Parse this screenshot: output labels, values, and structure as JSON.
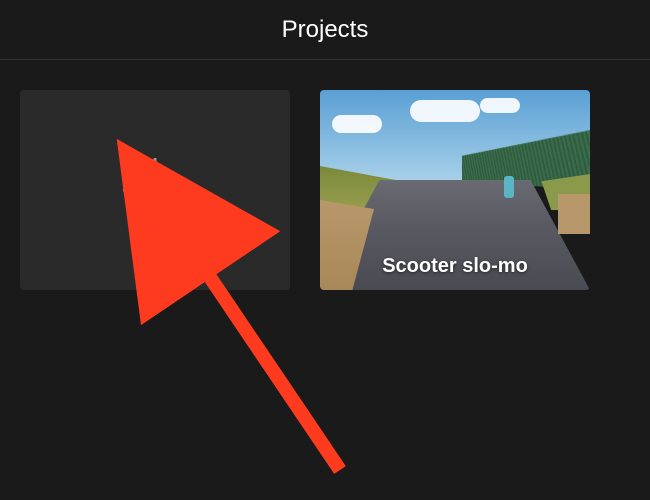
{
  "header": {
    "title": "Projects"
  },
  "projects": {
    "new_button": {
      "icon": "plus-icon"
    },
    "items": [
      {
        "title": "Scooter slo-mo"
      }
    ]
  },
  "annotation": {
    "arrow_color": "#ff3b1f"
  }
}
